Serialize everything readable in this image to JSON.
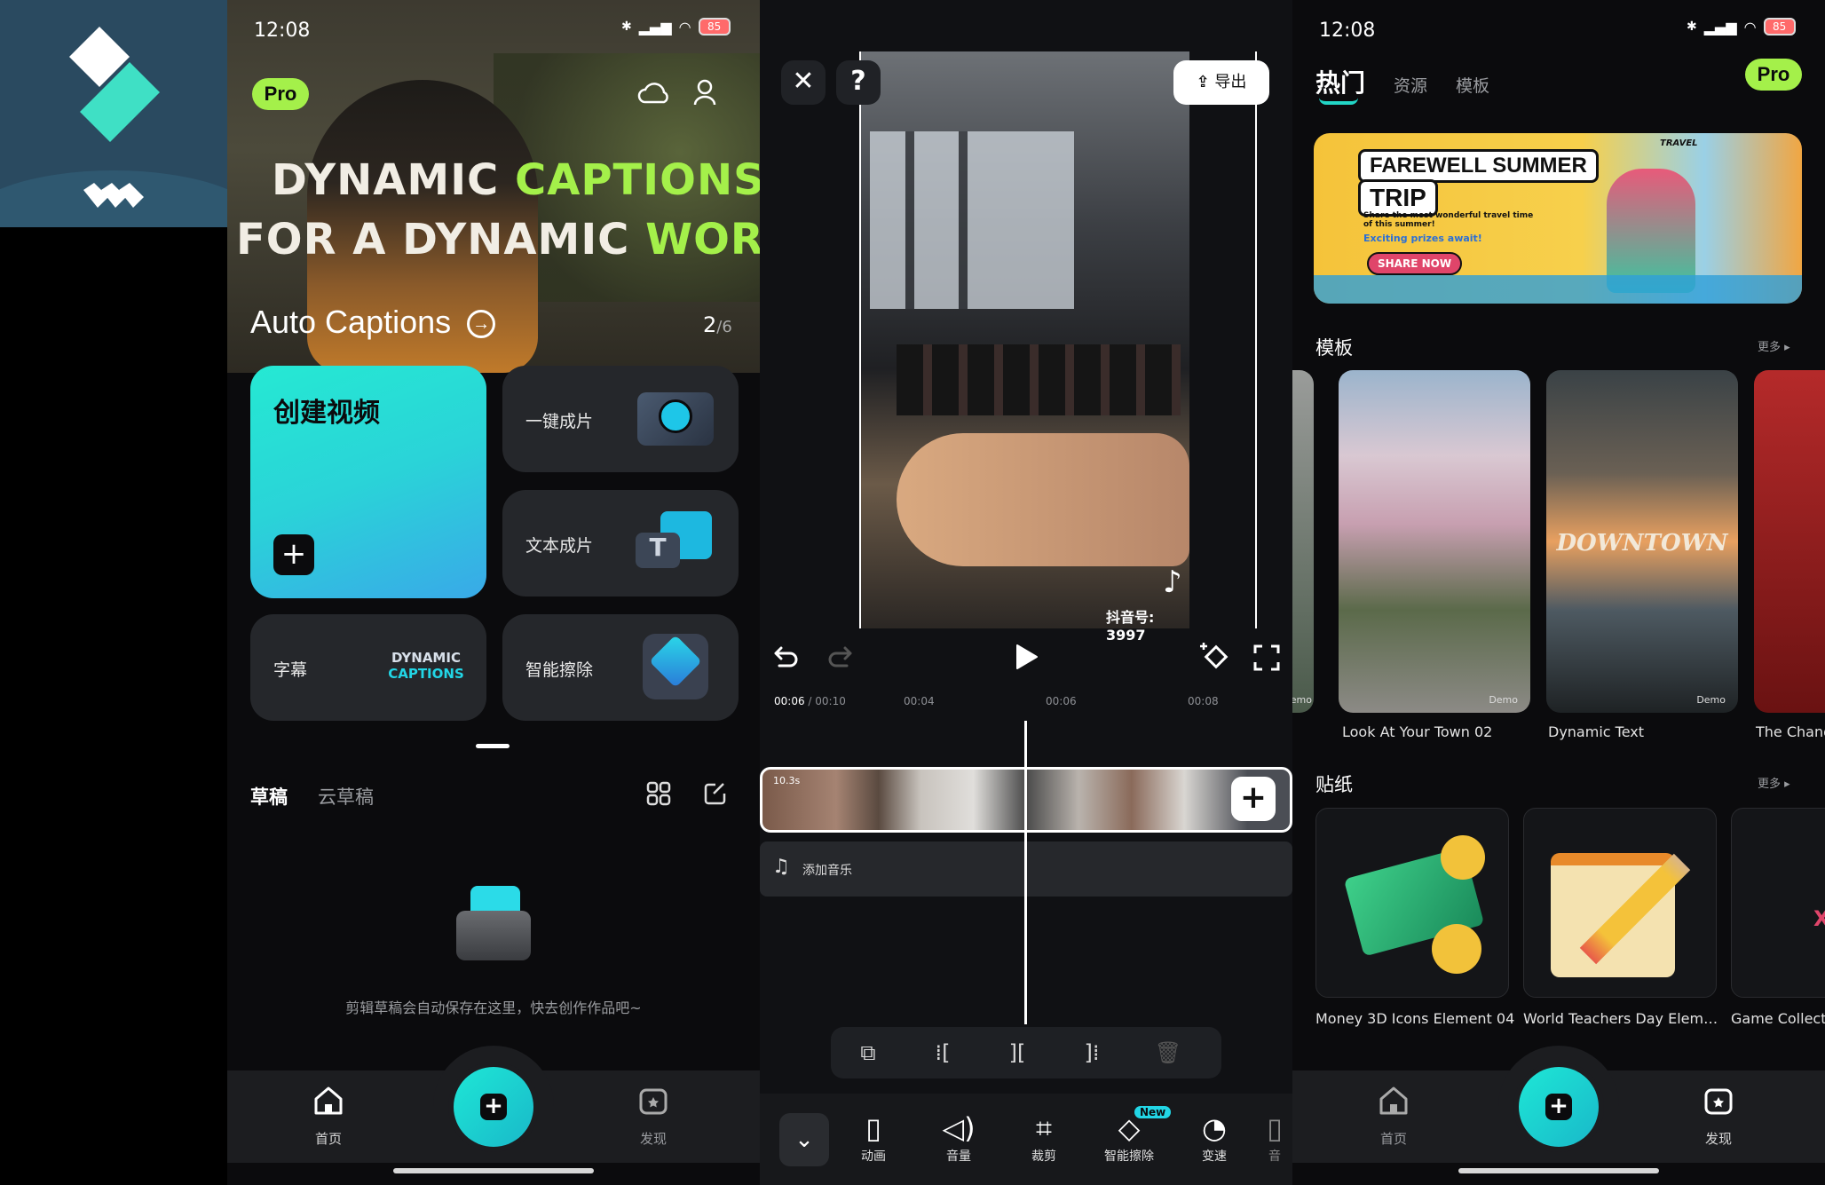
{
  "colors": {
    "accent": "#1ee7d6",
    "pro_badge": "#a4f04a",
    "background": "#0b0b0d"
  },
  "panel1": {
    "status": {
      "time": "12:08",
      "battery": "85"
    },
    "pro": "Pro",
    "icons": {
      "cloud": "cloud-icon",
      "profile": "profile-icon"
    },
    "hero": {
      "line1_a": "DYNAMIC ",
      "line1_b": "CAPTIONS",
      "line2_a": "FOR A DYNAMIC ",
      "line2_b": "WORLD",
      "subtitle": "Auto Captions",
      "page_current": "2",
      "page_total": "/6"
    },
    "cards": {
      "create": "创建视频",
      "one_click": "一键成片",
      "text_to_video": "文本成片",
      "subtitles": "字幕",
      "subtitle_art_1": "DYNAMIC",
      "subtitle_art_2": "CAPTIONS",
      "smart_erase": "智能擦除"
    },
    "tabs": {
      "drafts": "草稿",
      "cloud_drafts": "云草稿"
    },
    "empty_text": "剪辑草稿会自动保存在这里，快去创作作品吧~",
    "nav": {
      "home": "首页",
      "discover": "发现"
    }
  },
  "panel2": {
    "export": "导出",
    "watermark": "抖音号: 3997",
    "time_current": "00:06",
    "time_total": "/ 00:10",
    "ticks": [
      "00:04",
      "00:06",
      "00:08"
    ],
    "clip_length": "10.3s",
    "add_music": "添加音乐",
    "new_badge": "New",
    "tools": [
      "动画",
      "音量",
      "裁剪",
      "智能擦除",
      "变速",
      "音"
    ]
  },
  "panel3": {
    "status": {
      "time": "12:08",
      "battery": "85"
    },
    "tabs": {
      "hot": "热门",
      "resources": "资源",
      "templates": "模板"
    },
    "pro": "Pro",
    "banner": {
      "title1": "FAREWELL SUMMER",
      "title2": "TRIP",
      "desc": "Share the most wonderful travel time of this summer!",
      "desc2": "Exciting prizes await!",
      "cta": "SHARE NOW",
      "tag": "TRAVEL"
    },
    "sections": {
      "templates": "模板",
      "stickers": "贴纸",
      "more": "更多"
    },
    "templates": [
      {
        "name": "Look At Your Town 02",
        "badge": "Demo"
      },
      {
        "name": "Dynamic Text",
        "badge": "Demo",
        "overlay": "DOWNTOWN"
      },
      {
        "name": "The Chang",
        "badge": ""
      }
    ],
    "first_partial_badge": "Demo",
    "stickers": [
      {
        "name": "Money 3D Icons Element 04"
      },
      {
        "name": "World Teachers Day Elem…"
      },
      {
        "name": "Game Collectio"
      }
    ],
    "nav": {
      "home": "首页",
      "discover": "发现"
    }
  }
}
